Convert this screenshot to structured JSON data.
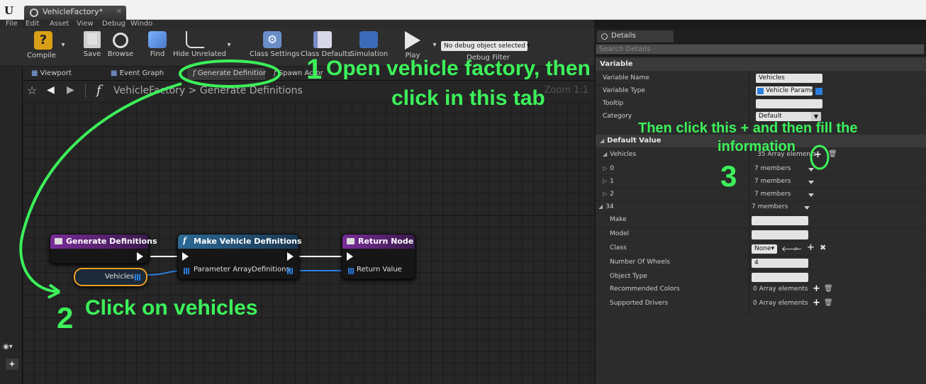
{
  "window": {
    "tab_title": "VehicleFactory*",
    "menu": [
      "File",
      "Edit",
      "Asset",
      "View",
      "Debug",
      "Windo"
    ]
  },
  "toolbar": {
    "compile": "Compile",
    "save": "Save",
    "browse": "Browse",
    "find": "Find",
    "hide_unrelated": "Hide Unrelated",
    "class_settings": "Class Settings",
    "class_defaults": "Class Defaults",
    "simulation": "Simulation",
    "play": "Play",
    "debug_object": "No debug object selected",
    "debug_filter": "Debug Filter"
  },
  "graph_tabs": [
    {
      "label": "Viewport"
    },
    {
      "label": "Event Graph"
    },
    {
      "label": "Generate Definitior"
    },
    {
      "label": "Spawn Actor"
    }
  ],
  "breadcrumb": {
    "root": "VehicleFactory",
    "separator": ">",
    "current": "Generate Definitions",
    "zoom": "Zoom 1:1"
  },
  "nodes": {
    "generate": {
      "title": "Generate Definitions"
    },
    "make": {
      "title": "Make Vehicle Definitions",
      "in_label": "Parameter Array",
      "out_label": "Definitions"
    },
    "ret": {
      "title": "Return Node",
      "in_label": "Return Value"
    },
    "vehicles": {
      "label": "Vehicles"
    }
  },
  "details": {
    "tab": "Details",
    "search_placeholder": "Search Details",
    "variable_category": "Variable",
    "rows": {
      "variable_name_label": "Variable Name",
      "variable_name_value": "Vehicles",
      "variable_type_label": "Variable Type",
      "variable_type_value": "Vehicle Parame",
      "tooltip_label": "Tooltip",
      "category_label": "Category",
      "category_value": "Default"
    },
    "default_value_category": "Default Value",
    "vehicles_label": "Vehicles",
    "vehicles_count": "35 Array elements",
    "elements": [
      {
        "index": "0",
        "value": "7 members"
      },
      {
        "index": "1",
        "value": "7 members"
      },
      {
        "index": "2",
        "value": "7 members"
      },
      {
        "index": "34",
        "value": "7 members"
      }
    ],
    "sub": {
      "make": "Make",
      "model": "Model",
      "class": "Class",
      "class_value": "None",
      "wheels": "Number Of Wheels",
      "wheels_value": "4",
      "object_type": "Object Type",
      "rec_colors": "Recommended Colors",
      "rec_colors_value": "0 Array elements",
      "drivers": "Supported Drivers",
      "drivers_value": "0 Array elements"
    }
  },
  "annotations": {
    "step1_num": "1",
    "step1_line1": "Open vehicle factory, then",
    "step1_line2": "click in this tab",
    "step2_num": "2",
    "step2_text": "Click on vehicles",
    "step3_line1": "Then click this + and then fill the",
    "step3_line2": "information",
    "step3_num": "3"
  },
  "colors": {
    "annotation": "#3cf25a",
    "function_header": "#2c5b7c",
    "event_header": "#6a2c8a",
    "array_pin": "#2a7fe0"
  }
}
